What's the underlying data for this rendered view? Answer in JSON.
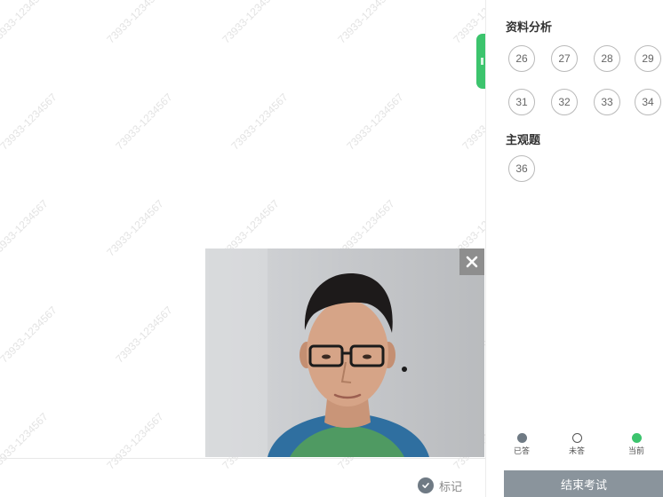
{
  "watermark": {
    "text": "73933-1234567"
  },
  "side_panel": {
    "sections": [
      {
        "title": "资料分析",
        "items": [
          "26",
          "27",
          "28",
          "29",
          "31",
          "32",
          "33",
          "34"
        ]
      },
      {
        "title": "主观题",
        "items": [
          "36"
        ]
      }
    ],
    "legend": [
      {
        "label": "已答",
        "color": "#6f7a84",
        "style": "filled"
      },
      {
        "label": "未答",
        "color": "#ffffff",
        "style": "outline"
      },
      {
        "label": "当前",
        "color": "#3cc46d",
        "style": "filled"
      }
    ],
    "end_button_label": "结束考试"
  },
  "footer": {
    "mark_label": "标记"
  },
  "colors": {
    "accent_green": "#3cc46d",
    "answered_gray": "#6f7a84",
    "button_gray": "#8a949c"
  },
  "icons": {
    "mark": "check-circle-icon",
    "close": "close-icon",
    "tab": "handle-icon"
  }
}
